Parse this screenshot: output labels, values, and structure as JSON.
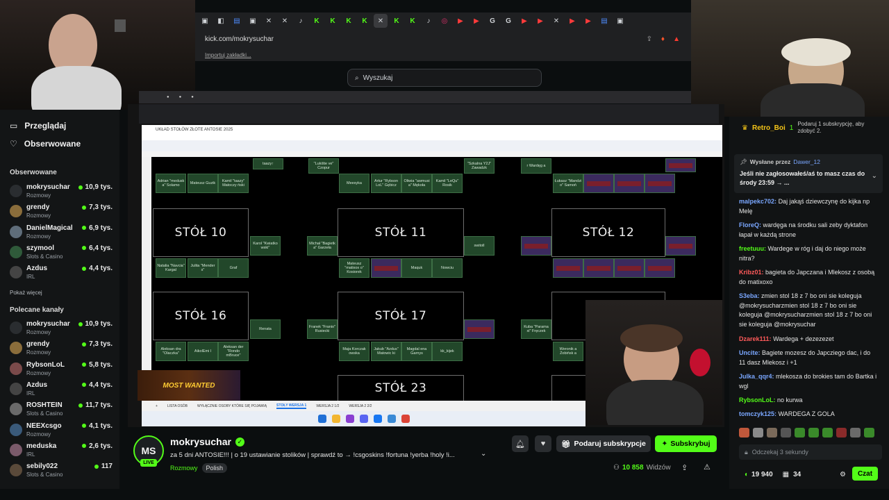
{
  "browser": {
    "url": "kick.com/mokrysuchar",
    "bookmark": "Importuj zakładki...",
    "search_placeholder": "Wyszukaj"
  },
  "sidebar": {
    "nav": [
      {
        "label": "Przeglądaj",
        "icon": "browse-icon"
      },
      {
        "label": "Obserwowane",
        "icon": "heart-icon"
      }
    ],
    "followed_header": "Obserwowane",
    "followed": [
      {
        "name": "mokrysuchar",
        "category": "Rozmowy",
        "viewers": "10,9 tys.",
        "color": "#2a2d30"
      },
      {
        "name": "grendy",
        "category": "Rozmowy",
        "viewers": "7,3 tys.",
        "color": "#8a6d3b"
      },
      {
        "name": "DanielMagical",
        "category": "Rozmowy",
        "viewers": "6,9 tys.",
        "color": "#5f6d7a"
      },
      {
        "name": "szymool",
        "category": "Slots & Casino",
        "viewers": "6,4 tys.",
        "color": "#2f5a3a"
      },
      {
        "name": "Azdus",
        "category": "IRL",
        "viewers": "4,4 tys.",
        "color": "#444"
      }
    ],
    "show_more": "Pokaż więcej",
    "recommended_header": "Polecane kanały",
    "recommended": [
      {
        "name": "mokrysuchar",
        "category": "Rozmowy",
        "viewers": "10,9 tys.",
        "color": "#2a2d30"
      },
      {
        "name": "grendy",
        "category": "Rozmowy",
        "viewers": "7,3 tys.",
        "color": "#8a6d3b"
      },
      {
        "name": "RybsonLoL",
        "category": "Rozmowy",
        "viewers": "5,8 tys.",
        "color": "#7a4a4a"
      },
      {
        "name": "Azdus",
        "category": "IRL",
        "viewers": "4,4 tys.",
        "color": "#444"
      },
      {
        "name": "ROSHTEIN",
        "category": "Slots & Casino",
        "viewers": "11,7 tys.",
        "color": "#6a6a6a"
      },
      {
        "name": "NEEXcsgo",
        "category": "Rozmowy",
        "viewers": "4,1 tys.",
        "color": "#3a5a7a"
      },
      {
        "name": "meduska",
        "category": "IRL",
        "viewers": "2,6 tys.",
        "color": "#7a5a6a"
      },
      {
        "name": "sebily022",
        "category": "Slots & Casino",
        "viewers": "117",
        "color": "#5a4a3a"
      }
    ]
  },
  "stream": {
    "sheet_title": "UKŁAD STOŁÓW ZŁOTE ANTOSIE 2025",
    "sheet_tabs": [
      "LISTA OSÓB",
      "WYŁĄCZNIE OSOBY KTÓRE SIĘ POJAWIĄ",
      "STOŁY WERSJA 1",
      "WERSJA 2 1/2",
      "WERSJA 2 2/2"
    ],
    "tables": [
      {
        "label": "STÓŁ 10"
      },
      {
        "label": "STÓŁ 11"
      },
      {
        "label": "STÓŁ 12"
      },
      {
        "label": "STÓŁ 16"
      },
      {
        "label": "STÓŁ 17"
      },
      {
        "label": "STÓŁ 23"
      }
    ],
    "seats": {
      "s1": "taazy↑",
      "s2": "\"Lukište ve\" Czopur",
      "s3": "\"Szkalna Y2J\" Zawadzk",
      "s4": "r Wardęg a",
      "s5": "Adrian \"medusk a\" Solamo",
      "s6": "Mateusz Guzik",
      "s7": "Kamil \"taazy\" Matoczy ński",
      "s8": "Meesyka",
      "s9": "Artur \"Rybson LoL\" Gębicz",
      "s10": "Oliwia \"awmusi a\" Mękoła",
      "s11": "Kamil \"LeQu\" Rosik",
      "s12": "Łukasz \"Mandzi o\" Samoń",
      "s13": "Karol \"Kwiatko wski\"",
      "s14": "Michał \"Bagietk a\" Garzeła",
      "s15": "switoll",
      "s16": "Natalia \"Navcia\" Kargal",
      "s17": "Julita \"Mender s\"",
      "s18": "Graf",
      "s19": "Mateusz \"matixox o\" Kosiorek",
      "s20": "Maquk",
      "s21": "Nowciu",
      "s22": "Renata",
      "s23": "Franek \"Franio\" Rusiecki",
      "s24": "Kuba \"Parama xi\" Fręczek",
      "s25": "Aleksan dra \"Olaczka\"",
      "s26": "AikolEmi l",
      "s27": "Aleksan der \"Rondo mBruce\"",
      "s28": "Maja Korczak owska",
      "s29": "Jakub \"Azdus\" Matowic ki",
      "s30": "Magdal ena Garnys",
      "s31": "kk_kijek",
      "s32": "Weronik a Żobińsk a"
    },
    "promo": "MOST WANTED"
  },
  "info": {
    "avatar_text": "MS",
    "live": "LIVE",
    "name": "mokrysuchar",
    "title": "za 5 dni ANTOSIE!!! | o 19 ustawianie stolików | sprawdź to → !csgoskins !fortuna !yerba !holy !i...",
    "category": "Rozmowy",
    "language": "Polish",
    "gift_label": "Podaruj subskrypcje",
    "sub_label": "Subskrybuj",
    "viewers": "10 858",
    "viewers_label": "Widzów"
  },
  "chat": {
    "top_user": "Retro_Boi",
    "top_count": "1",
    "top_info": "Podaruj 1 subskrypcję, aby zdobyć 2.",
    "pinned_by_label": "Wysłane przez",
    "pinned_by": "Dawer_12",
    "pinned_text": "Jeśli nie zagłosowałeś/aś to masz czas do środy 23:59 → ...",
    "messages": [
      {
        "user": "malpekc702:",
        "text": "Daj jakąś dziewczynę do kijka np Melę",
        "color": "#7aa7ff"
      },
      {
        "user": "FloreQ:",
        "text": "wardęga na środku sali zeby dyktafon łapał w każdą strone",
        "color": "#7aa7ff"
      },
      {
        "user": "freetuuu:",
        "text": "Wardege w róg i daj do niego może nitra?",
        "color": "#53fc18"
      },
      {
        "user": "Kribz01:",
        "text": "bagieta do Japczana i Mlekosz z osobą do matixoxo",
        "color": "#ff5a5a"
      },
      {
        "user": "S3eba:",
        "text": "zmien stol 18 z 7 bo oni sie koleguja @mokrysucharzmien stol 18 z 7 bo oni sie koleguja @mokrysucharzmien stol 18 z 7 bo oni sie koleguja @mokrysuchar",
        "color": "#7aa7ff"
      },
      {
        "user": "Dzarek111:",
        "text": "Wardega + dezezezet",
        "color": "#ff5a5a"
      },
      {
        "user": "Uncite:",
        "text": "Bagiete mozesz do Japcziego dac, i do 11 dasz Mlekosz i +1",
        "color": "#7aa7ff"
      },
      {
        "user": "Julka_qqr4:",
        "text": "mlekosza do brokies tam do Bartka i wgl",
        "color": "#7aa7ff"
      },
      {
        "user": "RybsonLoL:",
        "text": "no kurwa",
        "color": "#53fc18"
      },
      {
        "user": "tomczyk125:",
        "text": "WARDEGA Z GOLA",
        "color": "#7aa7ff"
      }
    ],
    "input_placeholder": "Odczekaj 3 sekundy",
    "points": "19 940",
    "gifts": "34",
    "send_label": "Czat"
  }
}
